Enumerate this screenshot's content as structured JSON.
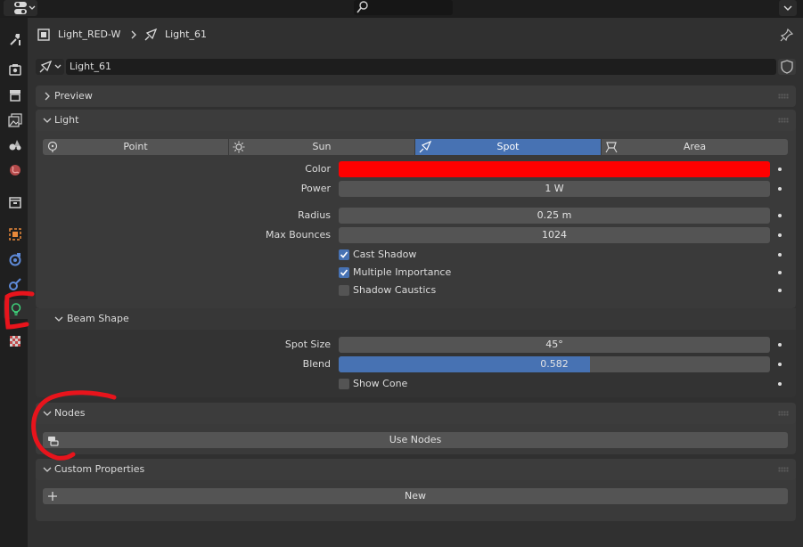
{
  "header": {
    "object_name": "Light_RED-W",
    "light_name": "Light_61"
  },
  "datablock": {
    "name": "Light_61"
  },
  "panels": {
    "preview": "Preview",
    "light": "Light",
    "beam_shape": "Beam Shape",
    "nodes": "Nodes",
    "custom_properties": "Custom Properties"
  },
  "light_types": [
    "Point",
    "Sun",
    "Spot",
    "Area"
  ],
  "selected_light_type": "Spot",
  "properties": {
    "color_label": "Color",
    "color_value": "#ff0000",
    "power_label": "Power",
    "power_value": "1 W",
    "radius_label": "Radius",
    "radius_value": "0.25 m",
    "max_bounces_label": "Max Bounces",
    "max_bounces_value": "1024",
    "cast_shadow": {
      "label": "Cast Shadow",
      "checked": true
    },
    "multiple_importance": {
      "label": "Multiple Importance",
      "checked": true
    },
    "shadow_caustics": {
      "label": "Shadow Caustics",
      "checked": false
    }
  },
  "beam": {
    "spot_size_label": "Spot Size",
    "spot_size_value": "45°",
    "blend_label": "Blend",
    "blend_value": "0.582",
    "blend_fraction": 0.582,
    "show_cone": {
      "label": "Show Cone",
      "checked": false
    }
  },
  "nodes": {
    "use_nodes_label": "Use Nodes"
  },
  "custom": {
    "new_label": "New"
  },
  "colors": {
    "accent": "#4772b3",
    "annotation": "#e8141c",
    "light_tab_icon": "#3ed17a"
  },
  "icons": {
    "sidebar": [
      "tool-icon",
      "render-icon",
      "output-icon",
      "view-layer-icon",
      "scene-icon",
      "world-icon",
      "collection-icon",
      "object-icon",
      "modifier-icon",
      "physics-icon",
      "light-data-icon",
      "texture-icon"
    ]
  }
}
